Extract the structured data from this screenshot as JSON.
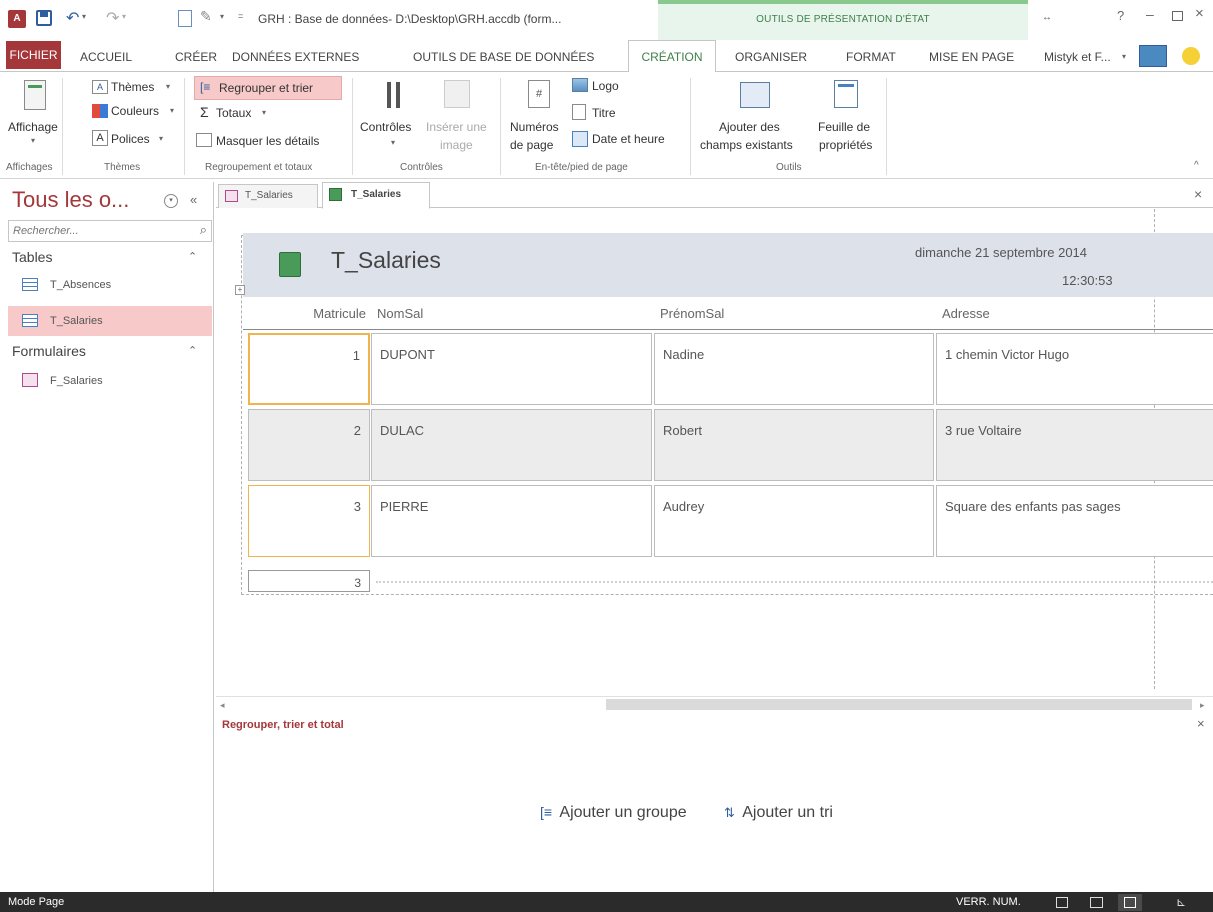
{
  "window": {
    "title": "GRH : Base de données- D:\\Desktop\\GRH.accdb (form...",
    "context_label": "OUTILS DE PRÉSENTATION D'ÉTAT",
    "help": "?",
    "account": "Mistyk et F..."
  },
  "tabs": [
    "FICHIER",
    "ACCUEIL",
    "CRÉER",
    "DONNÉES EXTERNES",
    "OUTILS DE BASE DE DONNÉES",
    "CRÉATION",
    "ORGANISER",
    "FORMAT",
    "MISE EN PAGE"
  ],
  "ribbon": {
    "affichage": "Affichage",
    "themes": "Thèmes",
    "couleurs": "Couleurs",
    "polices": "Polices",
    "regrouper": "Regrouper et trier",
    "totaux": "Totaux",
    "masquer": "Masquer les détails",
    "controles": "Contrôles",
    "inserer1": "Insérer une",
    "inserer2": "image",
    "numeros1": "Numéros",
    "numeros2": "de page",
    "logo": "Logo",
    "titre": "Titre",
    "date_heure": "Date et heure",
    "ajouter1": "Ajouter des",
    "ajouter2": "champs existants",
    "feuille1": "Feuille de",
    "feuille2": "propriétés",
    "groups": {
      "affichages": "Affichages",
      "themes": "Thèmes",
      "regroupement": "Regroupement et totaux",
      "controles": "Contrôles",
      "entete": "En-tête/pied de page",
      "outils": "Outils"
    }
  },
  "nav": {
    "title": "Tous les o...",
    "search_placeholder": "Rechercher...",
    "tables_header": "Tables",
    "tables": [
      "T_Absences",
      "T_Salaries"
    ],
    "forms_header": "Formulaires",
    "forms": [
      "F_Salaries"
    ]
  },
  "doc_tabs": [
    "T_Salaries",
    "T_Salaries"
  ],
  "report": {
    "title": "T_Salaries",
    "date": "dimanche 21 septembre 2014",
    "time": "12:30:53",
    "columns": [
      "Matricule",
      "NomSal",
      "PrénomSal",
      "Adresse"
    ],
    "rows": [
      {
        "matricule": "1",
        "nom": "DUPONT",
        "prenom": "Nadine",
        "adresse": "1 chemin Victor Hugo"
      },
      {
        "matricule": "2",
        "nom": "DULAC",
        "prenom": "Robert",
        "adresse": "3 rue Voltaire"
      },
      {
        "matricule": "3",
        "nom": "PIERRE",
        "prenom": "Audrey",
        "adresse": "Square des enfants pas sages"
      }
    ],
    "count": "3"
  },
  "group_panel": {
    "title": "Regrouper, trier et total",
    "add_group": "Ajouter un groupe",
    "add_sort": "Ajouter un tri"
  },
  "status": {
    "mode": "Mode Page",
    "numlock": "VERR. NUM."
  },
  "colors": {
    "accent": "#a4373a",
    "context": "#3f8049",
    "selected": "#f7c9c9",
    "header_band": "#dde2ea",
    "focus": "#f0b44c"
  }
}
